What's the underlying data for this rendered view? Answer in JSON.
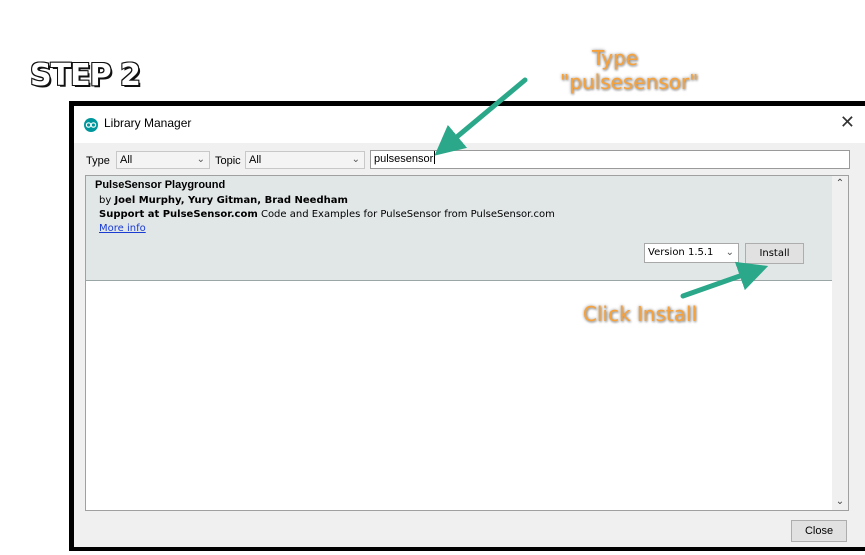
{
  "step_label": "STEP 2",
  "annotations": {
    "type_line1": "Type",
    "type_line2": "\"pulsesensor\"",
    "click_install": "Click Install",
    "color": "#f7a13a",
    "arrow_color": "#2aa889"
  },
  "window": {
    "title": "Library Manager",
    "app_icon": "arduino-logo-icon",
    "close_glyph": "✕"
  },
  "filters": {
    "type_label": "Type",
    "type_value": "All",
    "topic_label": "Topic",
    "topic_value": "All",
    "search_value": "pulsesensor"
  },
  "library": {
    "name": "PulseSensor Playground",
    "by_prefix": "by ",
    "authors": "Joel Murphy, Yury Gitman, Brad Needham",
    "sentence": "Support at PulseSensor.com",
    "description": " Code and Examples for PulseSensor from PulseSensor.com",
    "more_info": "More info",
    "version": "Version 1.5.1",
    "install_label": "Install"
  },
  "footer": {
    "close_label": "Close"
  }
}
